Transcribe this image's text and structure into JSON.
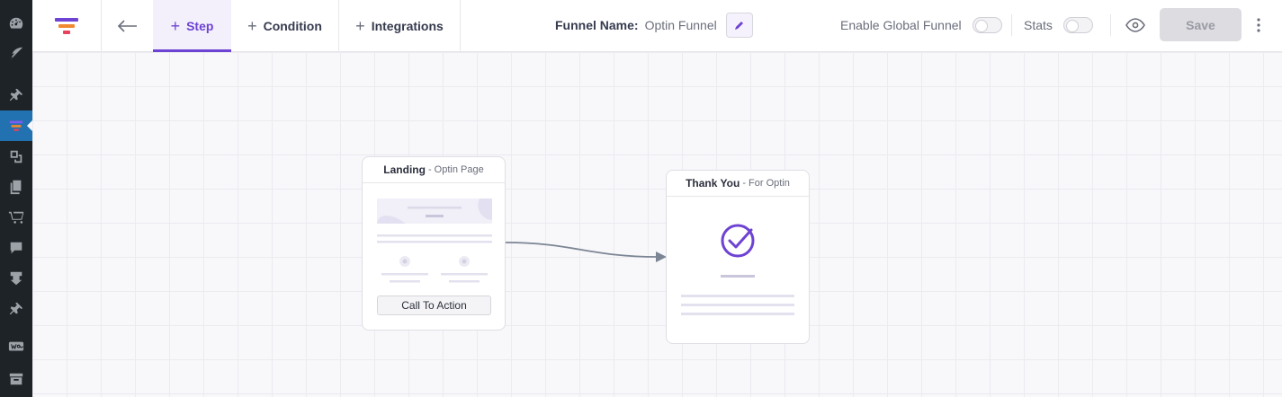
{
  "toolbar": {
    "tabs": [
      {
        "label": "Step",
        "active": true
      },
      {
        "label": "Condition",
        "active": false
      },
      {
        "label": "Integrations",
        "active": false
      }
    ],
    "funnel_name_label": "Funnel Name:",
    "funnel_name_value": "Optin Funnel",
    "enable_global_label": "Enable Global Funnel",
    "stats_label": "Stats",
    "save_label": "Save"
  },
  "nodes": [
    {
      "title": "Landing",
      "subtitle": "- Optin Page",
      "cta": "Call To Action"
    },
    {
      "title": "Thank You",
      "subtitle": "- For Optin"
    }
  ],
  "colors": {
    "accent": "#6e42d3",
    "wp_sidebar": "#1d2327",
    "wp_active": "#2271b1",
    "edge": "#7c8594"
  },
  "icons": {
    "sidebar": [
      "dashboard-icon",
      "feather-icon",
      "pin-icon",
      "funnel-icon",
      "media-icon",
      "pages-icon",
      "cart-icon",
      "comments-icon",
      "download-icon",
      "pin-icon",
      "woo-icon",
      "archive-icon"
    ],
    "toolbar": [
      "funnel-logo-icon",
      "arrow-left-icon",
      "plus-icon",
      "pencil-icon",
      "eye-icon",
      "vertical-dots-icon"
    ]
  }
}
